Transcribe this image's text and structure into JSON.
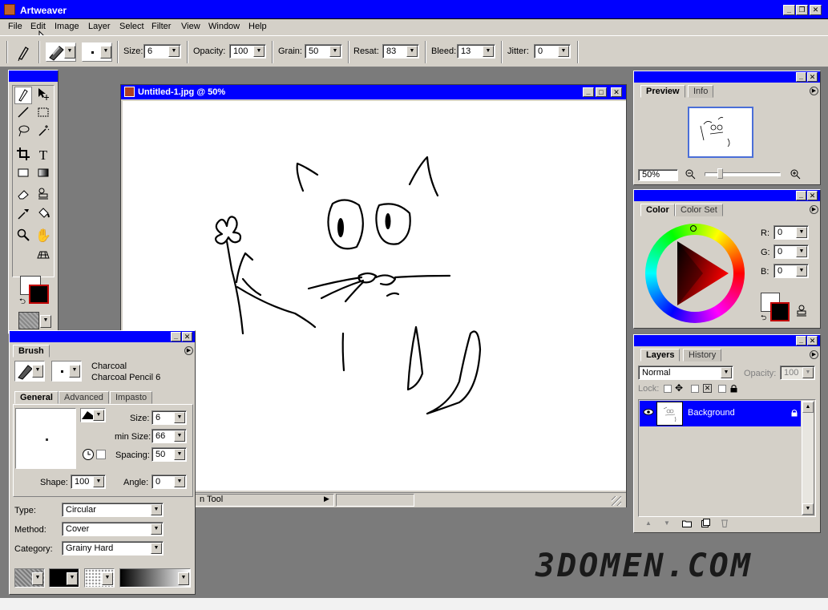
{
  "app": {
    "title": "Artweaver"
  },
  "menu": [
    "File",
    "Edit",
    "Image",
    "Layer",
    "Select",
    "Filter",
    "View",
    "Window",
    "Help"
  ],
  "options": {
    "size_label": "Size:",
    "size": "6",
    "opacity_label": "Opacity:",
    "opacity": "100",
    "grain_label": "Grain:",
    "grain": "50",
    "resat_label": "Resat:",
    "resat": "83",
    "bleed_label": "Bleed:",
    "bleed": "13",
    "jitter_label": "Jitter:",
    "jitter": "0"
  },
  "document": {
    "title": "Untitled-1.jpg @ 50%",
    "status_tool": "n Tool"
  },
  "brush": {
    "panel_tab": "Brush",
    "category": "Charcoal",
    "variant": "Charcoal Pencil 6",
    "tabs": [
      "General",
      "Advanced",
      "Impasto"
    ],
    "size_label": "Size:",
    "size": "6",
    "minsize_label": "min Size:",
    "minsize": "66",
    "spacing_label": "Spacing:",
    "spacing": "50",
    "shape_label": "Shape:",
    "shape": "100",
    "angle_label": "Angle:",
    "angle": "0",
    "type_label": "Type:",
    "type": "Circular",
    "method_label": "Method:",
    "method": "Cover",
    "category_label": "Category:",
    "category_value": "Grainy Hard"
  },
  "preview": {
    "tabs": [
      "Preview",
      "Info"
    ],
    "zoom": "50%"
  },
  "color": {
    "tabs": [
      "Color",
      "Color Set"
    ],
    "r_label": "R:",
    "r": "0",
    "g_label": "G:",
    "g": "0",
    "b_label": "B:",
    "b": "0"
  },
  "layers": {
    "tabs": [
      "Layers",
      "History"
    ],
    "blend": "Normal",
    "opacity_label": "Opacity:",
    "opacity": "100",
    "lock_label": "Lock:",
    "layer_name": "Background"
  },
  "watermark": "3DOMEN.COM",
  "colors": {
    "titlebar": "#0000ff",
    "chrome": "#d4d0c8",
    "workspace": "#7b7b7b"
  }
}
